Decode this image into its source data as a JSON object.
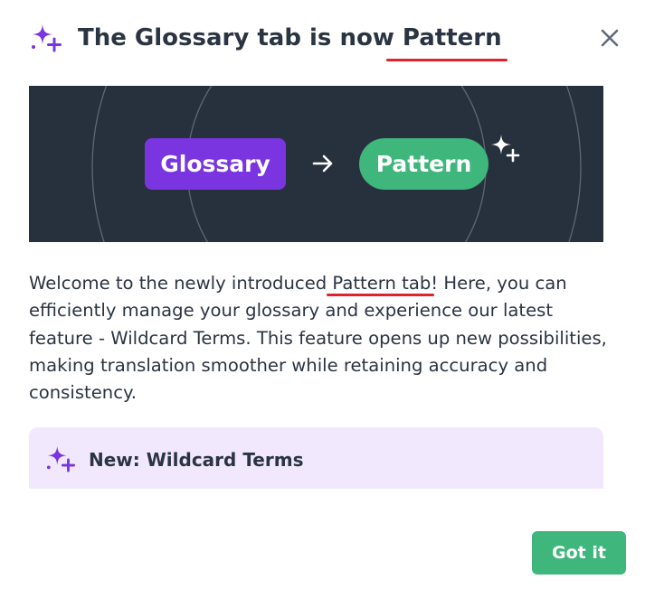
{
  "header": {
    "title_prefix": "The Glossary tab is now ",
    "title_highlight": "Pattern",
    "icon": "sparkles-icon",
    "close_icon": "close-icon"
  },
  "banner": {
    "from_label": "Glossary",
    "to_label": "Pattern",
    "arrow_icon": "arrow-right-icon",
    "sparkle_icon": "sparkles-icon"
  },
  "body": {
    "text_before": "Welcome to the newly introduced ",
    "highlight": "Pattern tab",
    "text_after": "! Here, you can efficiently manage your glossary and experience our latest feature - Wildcard Terms. This feature opens up new possibilities, making translation smoother while retaining accuracy and consistency."
  },
  "callout": {
    "icon": "sparkles-icon",
    "title": "New: Wildcard Terms"
  },
  "footer": {
    "got_it_label": "Got it"
  },
  "colors": {
    "accent_purple": "#7a35e0",
    "accent_green": "#3fb67b",
    "banner_bg": "#27313d",
    "callout_bg": "#f1e8fd",
    "underline_red": "#e0212f"
  }
}
